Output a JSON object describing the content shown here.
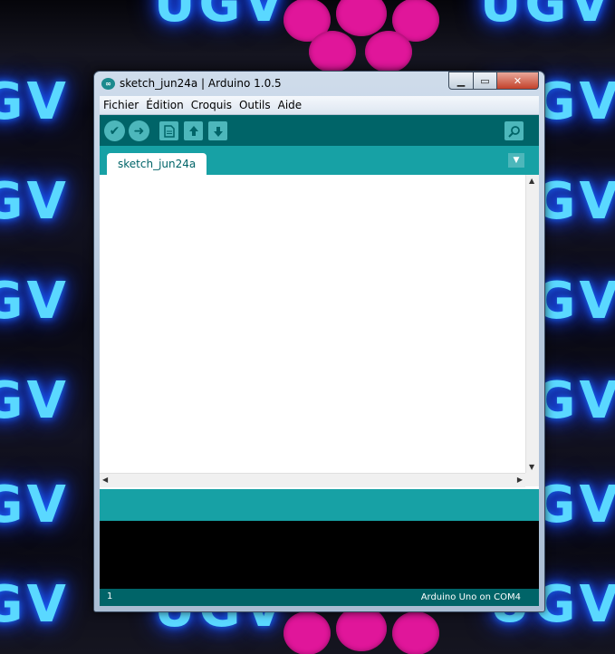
{
  "wallpaper": {
    "text": "UGV"
  },
  "window": {
    "title": "sketch_jun24a | Arduino 1.0.5",
    "icon": "arduino-infinity-icon",
    "controls": {
      "minimize": "minimize-icon",
      "maximize": "maximize-icon",
      "close": "close-icon"
    }
  },
  "menubar": {
    "items": [
      {
        "label": "Fichier"
      },
      {
        "label": "Édition"
      },
      {
        "label": "Croquis"
      },
      {
        "label": "Outils"
      },
      {
        "label": "Aide"
      }
    ]
  },
  "toolbar": {
    "buttons": [
      {
        "name": "verify",
        "icon": "check-icon"
      },
      {
        "name": "upload",
        "icon": "arrow-right-icon"
      },
      {
        "name": "new",
        "icon": "new-document-icon"
      },
      {
        "name": "open",
        "icon": "arrow-up-icon"
      },
      {
        "name": "save",
        "icon": "arrow-down-icon"
      },
      {
        "name": "serial-monitor",
        "icon": "magnifier-icon"
      }
    ]
  },
  "tabs": {
    "active": "sketch_jun24a"
  },
  "footer": {
    "line": "1",
    "board": "Arduino Uno on COM4"
  },
  "colors": {
    "toolbar": "#006468",
    "tabbar": "#17a1a5",
    "button": "#4db7bb",
    "console": "#000000"
  }
}
